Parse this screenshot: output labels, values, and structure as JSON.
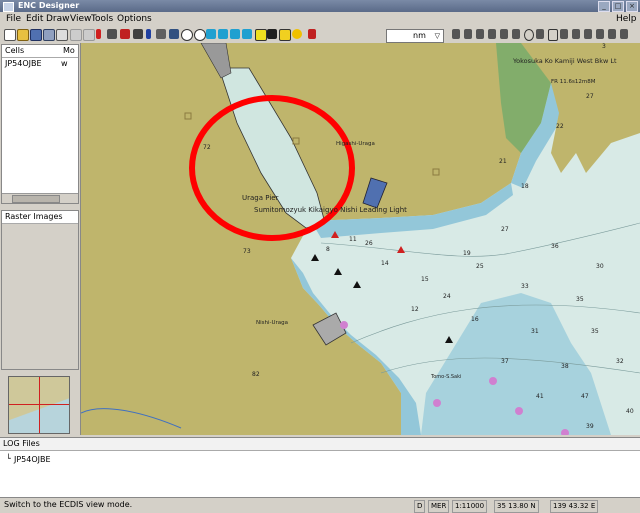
{
  "window": {
    "title": "ENC Designer"
  },
  "window_buttons": [
    "_",
    "□",
    "×"
  ],
  "menus": [
    "File",
    "Edit",
    "Draw",
    "View",
    "Tools",
    "Options"
  ],
  "help": "Help",
  "toolbar": {
    "units": "nm"
  },
  "cells": {
    "col1": "Cells",
    "col2": "Mo",
    "items": [
      {
        "name": "JP54OJBE",
        "mode": "w"
      }
    ]
  },
  "raster": {
    "header": "Raster Images"
  },
  "map": {
    "labels": {
      "north": "Yokosuka Ko Kamiji West Bkw Lt",
      "fr": "FR 11.6s12m8M",
      "higashi": "Higashi-Uraga",
      "uraga_pier": "Uraga Pier",
      "sumitomo": "Sumitomozyuk Kikaigyo Nishi Leading Light",
      "nishi": "Nishi-Uraga",
      "tomo": "Tomo-S.Saki"
    },
    "depths": [
      "72",
      "73",
      "82",
      "3",
      "21",
      "15",
      "24",
      "26",
      "27",
      "22",
      "18",
      "27",
      "36",
      "30",
      "25",
      "33",
      "35",
      "14",
      "11",
      "8",
      "12",
      "16",
      "31",
      "35",
      "37",
      "38",
      "32",
      "41",
      "47",
      "40",
      "39",
      "19"
    ]
  },
  "log": {
    "header": "LOG Files",
    "items": [
      "JP54OJBE"
    ]
  },
  "status": {
    "message": "Switch to the ECDIS view mode.",
    "fields": [
      "D",
      "MER",
      "1:11000",
      "35 13.80 N",
      "139 43.32 E"
    ]
  }
}
